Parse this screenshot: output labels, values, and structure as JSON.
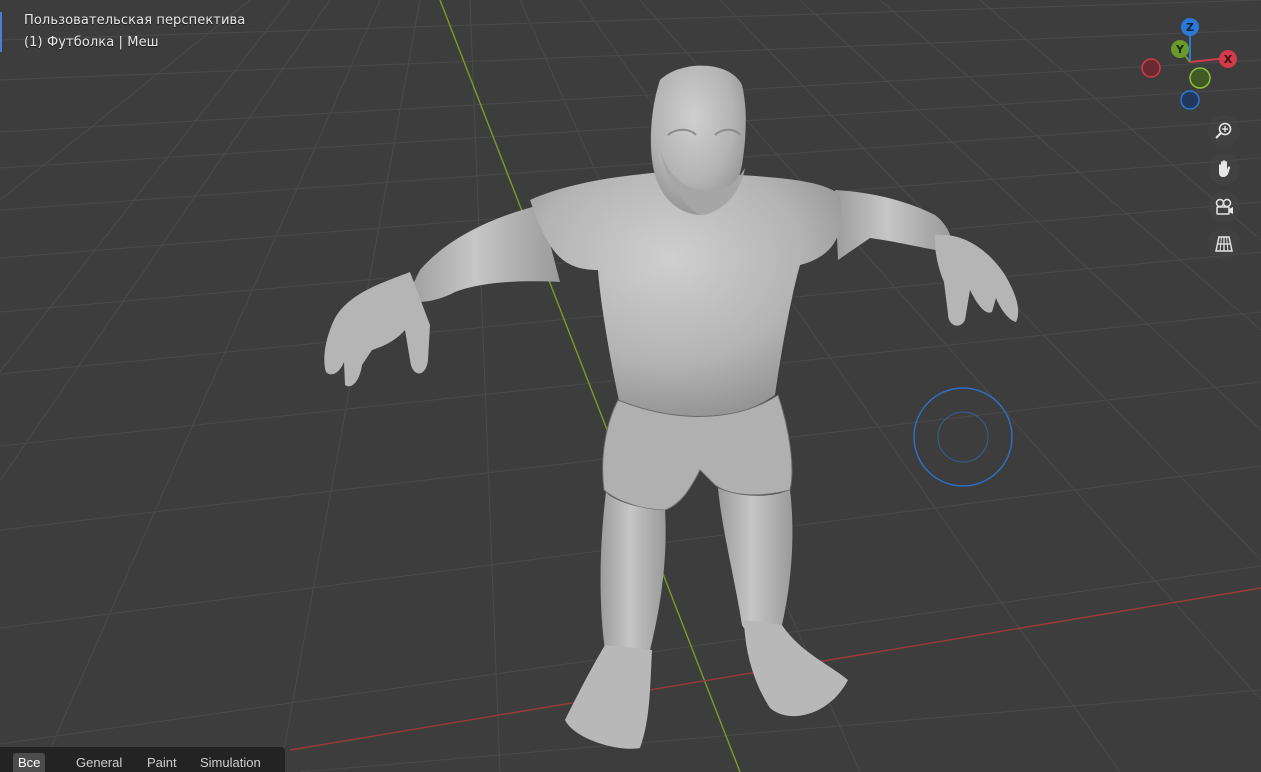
{
  "viewport": {
    "view_name": "Пользовательская перспектива",
    "object_info": "(1) Футболка | Меш"
  },
  "gizmo": {
    "z_label": "Z",
    "y_label": "Y",
    "x_label": "X",
    "colors": {
      "x": "#d33b4c",
      "y": "#6a9a2b",
      "z": "#2c78d6"
    }
  },
  "nav_buttons": {
    "zoom": "zoom-icon",
    "pan": "hand-icon",
    "camera": "camera-icon",
    "ortho": "grid-icon"
  },
  "tabs": [
    {
      "label": "Все",
      "active": true
    },
    {
      "label": "General",
      "active": false
    },
    {
      "label": "Paint",
      "active": false
    },
    {
      "label": "Simulation",
      "active": false
    }
  ],
  "colors": {
    "background": "#3d3d3d",
    "grid": "#4a4a4a",
    "axis_x": "#9a3a3a",
    "axis_y": "#7a9a2a",
    "mesh": "#b8b8b8",
    "cursor": "#2f6fc0"
  }
}
